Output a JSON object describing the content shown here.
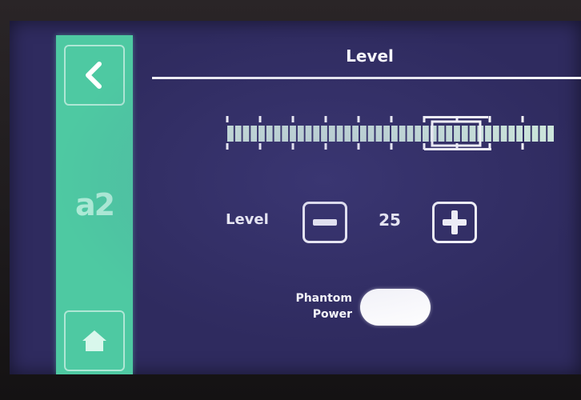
{
  "header": {
    "title": "Level"
  },
  "sidebar": {
    "back_icon": "chevron-left-icon",
    "channel_label": "a2",
    "home_icon": "home-icon"
  },
  "level": {
    "label": "Level",
    "value": "25",
    "minus_icon": "minus-icon",
    "plus_icon": "plus-icon"
  },
  "phantom_power": {
    "label_line1": "Phantom",
    "label_line2": "Power",
    "state": "on"
  },
  "colors": {
    "screen_bg": "#2f2b5f",
    "sidebar": "#4ec9a2",
    "foreground": "#ffffff"
  }
}
